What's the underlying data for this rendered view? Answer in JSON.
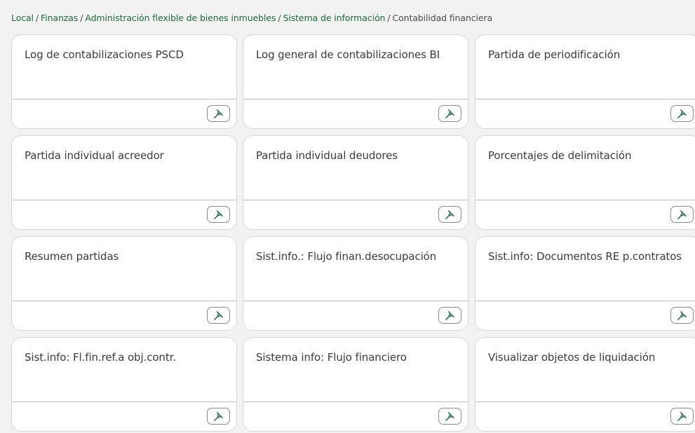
{
  "breadcrumb": {
    "items": [
      "Local",
      "Finanzas",
      "Administración flexible de bienes inmuebles",
      "Sistema de información"
    ],
    "separator": "/",
    "current": "Contabilidad financiera"
  },
  "tiles": [
    {
      "title": "Log de contabilizaciones PSCD"
    },
    {
      "title": "Log general de contabilizaciones BI"
    },
    {
      "title": "Partida de periodificación"
    },
    {
      "title": "Partida individual acreedor"
    },
    {
      "title": "Partida individual deudores"
    },
    {
      "title": "Porcentajes de delimitación"
    },
    {
      "title": "Resumen partidas"
    },
    {
      "title": "Sist.info.: Flujo finan.desocupación"
    },
    {
      "title": "Sist.info: Documentos RE p.contratos"
    },
    {
      "title": "Sist.info: Fl.fin.ref.a obj.contr."
    },
    {
      "title": "Sistema info: Flujo financiero"
    },
    {
      "title": "Visualizar objetos de liquidación"
    }
  ],
  "icons": {
    "pin": "pin-icon"
  },
  "colors": {
    "link": "#1b6b3a",
    "pin": "#1e6a3c",
    "background": "#f2f2f2",
    "tile": "#ffffff"
  }
}
